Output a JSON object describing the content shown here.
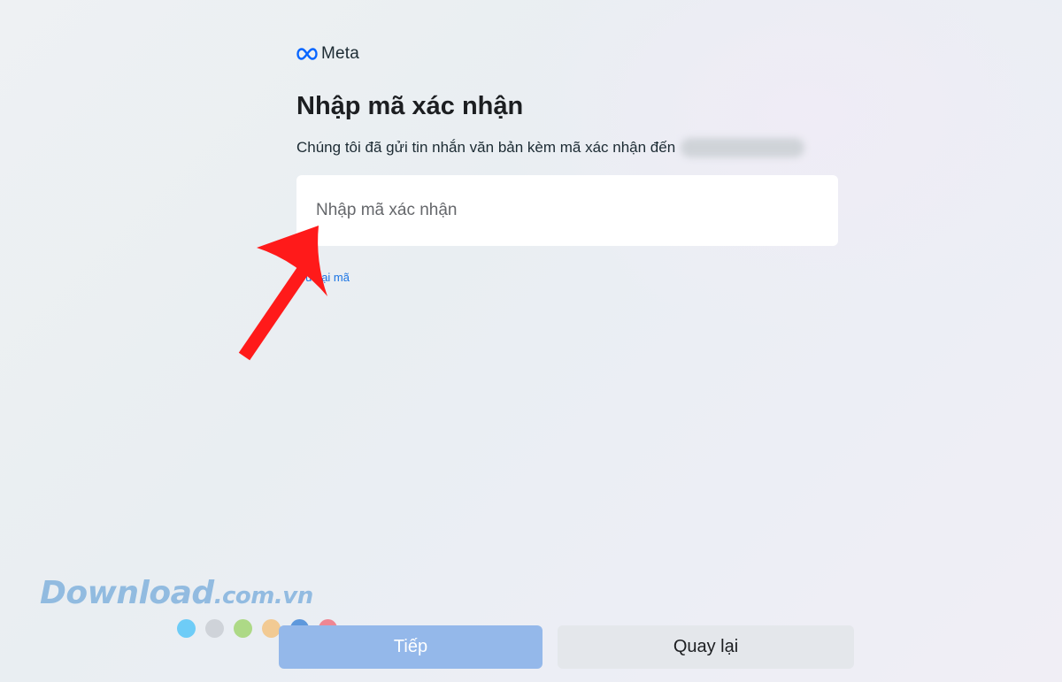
{
  "brand": {
    "logo_text": "Meta",
    "logo_color": "#0866ff"
  },
  "page": {
    "title": "Nhập mã xác nhận",
    "subtitle": "Chúng tôi đã gửi tin nhắn văn bản kèm mã xác nhận đến"
  },
  "code_field": {
    "value": "",
    "placeholder": "Nhập mã xác nhận"
  },
  "resend_link": "Gửi lại mã",
  "buttons": {
    "next_label": "Tiếp",
    "back_label": "Quay lại"
  },
  "annotation": {
    "arrow_color": "#ff1a1a"
  },
  "watermark": {
    "main": "Download",
    "domain": ".com.vn",
    "dot_colors": [
      "#4fc3f7",
      "#c8ccd2",
      "#9ed36a",
      "#f4c07a",
      "#3b82d6",
      "#f06b7a"
    ]
  },
  "colors": {
    "primary_disabled": "#94b8ea",
    "secondary": "#e4e7eb",
    "link": "#1b74e4"
  }
}
